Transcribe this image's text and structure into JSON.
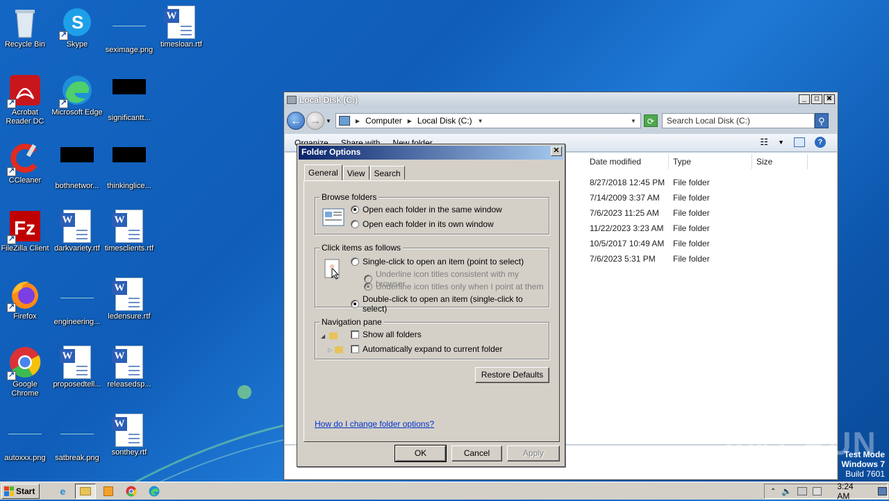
{
  "desktop": {
    "icons": [
      {
        "label": "Recycle Bin"
      },
      {
        "label": "Skype"
      },
      {
        "label": "seximage.png"
      },
      {
        "label": "timesloan.rtf"
      },
      {
        "label": "Acrobat Reader DC"
      },
      {
        "label": "Microsoft Edge"
      },
      {
        "label": "significantt..."
      },
      {
        "label": "CCleaner"
      },
      {
        "label": "bothnetwor..."
      },
      {
        "label": "thinkinglice..."
      },
      {
        "label": "FileZilla Client"
      },
      {
        "label": "darkvariety.rtf"
      },
      {
        "label": "timesclients.rtf"
      },
      {
        "label": "Firefox"
      },
      {
        "label": "engineering..."
      },
      {
        "label": "ledensure.rtf"
      },
      {
        "label": "Google Chrome"
      },
      {
        "label": "proposedtell..."
      },
      {
        "label": "releasedsp..."
      },
      {
        "label": "autoxxx.png"
      },
      {
        "label": "satbreak.png"
      },
      {
        "label": "sonthey.rtf"
      }
    ]
  },
  "explorer": {
    "title": "Local Disk (C:)",
    "breadcrumb": [
      "Computer",
      "Local Disk (C:)"
    ],
    "search_placeholder": "Search Local Disk (C:)",
    "toolbar": {
      "organize": "Organize",
      "share_with": "Share with",
      "new_folder": "New folder"
    },
    "columns": [
      "Date modified",
      "Type",
      "Size"
    ],
    "rows": [
      {
        "date": "8/27/2018 12:45 PM",
        "type": "File folder"
      },
      {
        "date": "7/14/2009 3:37 AM",
        "type": "File folder"
      },
      {
        "date": "7/6/2023 11:25 AM",
        "type": "File folder"
      },
      {
        "date": "11/22/2023 3:23 AM",
        "type": "File folder"
      },
      {
        "date": "10/5/2017 10:49 AM",
        "type": "File folder"
      },
      {
        "date": "7/6/2023 5:31 PM",
        "type": "File folder"
      }
    ]
  },
  "dialog": {
    "title": "Folder Options",
    "tabs": [
      "General",
      "View",
      "Search"
    ],
    "browse": {
      "legend": "Browse folders",
      "opt_same": "Open each folder in the same window",
      "opt_own": "Open each folder in its own window"
    },
    "click": {
      "legend": "Click items as follows",
      "single": "Single-click to open an item (point to select)",
      "underline_browser": "Underline icon titles consistent with my browser",
      "underline_point": "Underline icon titles only when I point at them",
      "double": "Double-click to open an item (single-click to select)"
    },
    "nav": {
      "legend": "Navigation pane",
      "show_all": "Show all folders",
      "auto_expand": "Automatically expand to current folder"
    },
    "restore_defaults": "Restore Defaults",
    "help_link": "How do I change folder options?",
    "ok": "OK",
    "cancel": "Cancel",
    "apply": "Apply"
  },
  "taskbar": {
    "start": "Start",
    "clock": "3:24 AM"
  },
  "watermark": {
    "line1": "Test Mode",
    "line2": "Windows 7",
    "line3": "Build 7601",
    "brand": "ANY RUN"
  }
}
